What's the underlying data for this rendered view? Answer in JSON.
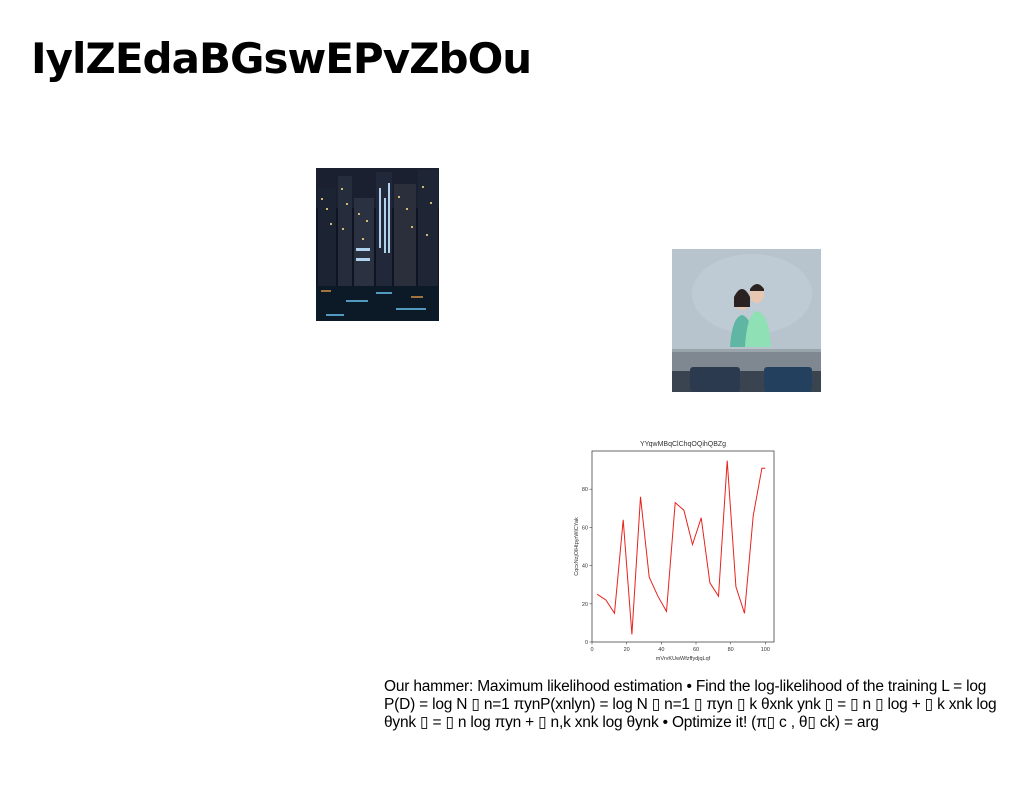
{
  "slide": {
    "title": "IylZEdaBGswEPvZbOu",
    "body_text": "Our hammer: Maximum likelihood estimation • Find the log-likelihood of the training L = log P(D) = log N ▯ n=1 πynP(xnlyn) = log N ▯ n=1 ▯ πyn ▯ k θxnk ynk ▯ = ▯ n ▯ log + ▯ k xnk log θynk ▯ = ▯ n log πyn + ▯ n,k xnk log θynk • Optimize it! (π▯ c , θ▯ ck) = arg"
  },
  "images": {
    "city": {
      "depicts": "night city skyline with lit skyscrapers and water reflections"
    },
    "couple": {
      "depicts": "young couple sitting at a grey table against a blue-grey wall"
    }
  },
  "chart_data": {
    "type": "line",
    "title": "YYqwMBqClChqOQihQBZg",
    "xlabel": "mVrvKUwWfzffydjqLqf",
    "ylabel": "CqcxNzjOlHtpyrWiCYak",
    "xlim": [
      0,
      105
    ],
    "ylim": [
      0,
      100
    ],
    "xticks": [
      0,
      20,
      40,
      60,
      80,
      100
    ],
    "yticks": [
      0,
      20,
      40,
      60,
      80
    ],
    "grid": false,
    "color": "#e8231d",
    "series": [
      {
        "x": [
          3,
          8,
          13,
          18,
          23,
          28,
          33,
          38,
          43,
          48,
          53,
          58,
          63,
          68,
          73,
          78,
          83,
          88,
          93,
          98,
          100
        ],
        "values": [
          25,
          22,
          15,
          64,
          4,
          76,
          34,
          24,
          16,
          73,
          69,
          51,
          65,
          31,
          24,
          95,
          29,
          15,
          66,
          91,
          91
        ]
      }
    ]
  }
}
